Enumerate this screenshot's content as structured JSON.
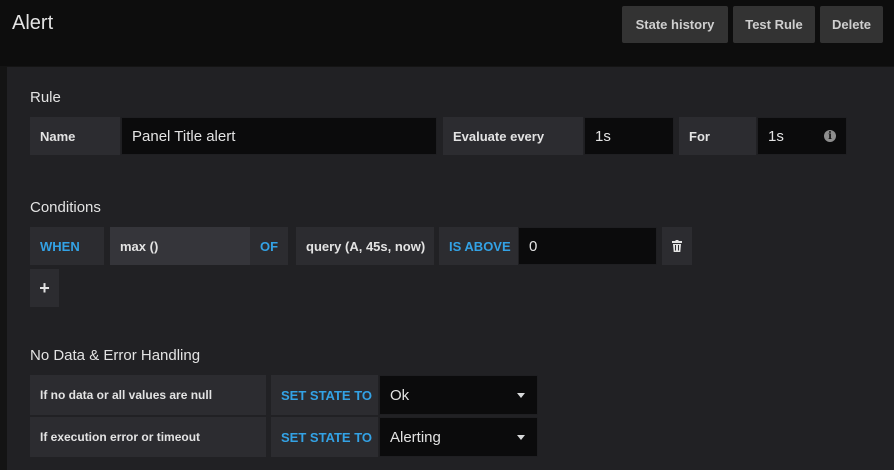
{
  "header": {
    "title": "Alert",
    "buttons": {
      "state_history": "State history",
      "test_rule": "Test Rule",
      "delete": "Delete"
    }
  },
  "rule": {
    "section_title": "Rule",
    "name_label": "Name",
    "name_value": "Panel Title alert",
    "evaluate_label": "Evaluate every",
    "evaluate_value": "1s",
    "for_label": "For",
    "for_value": "1s",
    "info_icon": "i"
  },
  "conditions": {
    "section_title": "Conditions",
    "when": "WHEN",
    "reducer": "max ()",
    "of": "OF",
    "query": "query (A, 45s, now)",
    "evaluator": "IS ABOVE",
    "threshold": "0",
    "add_icon": "+"
  },
  "no_data": {
    "section_title": "No Data & Error Handling",
    "rows": [
      {
        "label": "If no data or all values are null",
        "set_state": "SET STATE TO",
        "value": "Ok"
      },
      {
        "label": "If execution error or timeout",
        "set_state": "SET STATE TO",
        "value": "Alerting"
      }
    ]
  },
  "colors": {
    "accent": "#33a2e5",
    "background": "#141414",
    "panel": "#212124",
    "label_bg": "#2c2c30",
    "input_bg": "#0b0b0c"
  },
  "icons": {
    "trash": "trash-icon",
    "plus": "plus-icon",
    "info": "info-icon",
    "caret": "caret-down-icon"
  }
}
